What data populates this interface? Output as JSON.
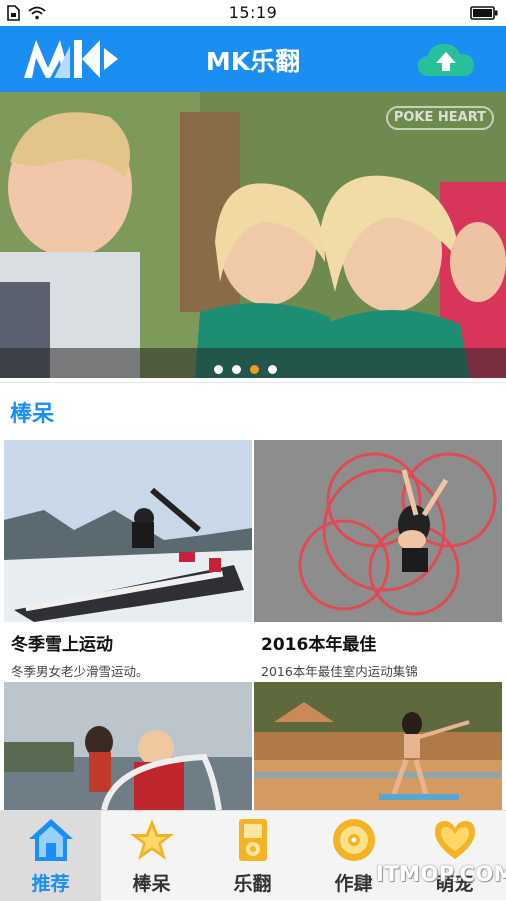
{
  "status_bar": {
    "time": "15:19"
  },
  "header": {
    "title": "MK乐翻",
    "upload_icon": "cloud-upload-icon",
    "logo": "mk-logo"
  },
  "banner": {
    "dots": 4,
    "active_dot": 3,
    "watermark": "POKE HEART"
  },
  "section": {
    "title": "棒呆"
  },
  "cards": [
    {
      "title": "冬季雪上运动",
      "subtitle": "冬季男女老少滑雪运动。"
    },
    {
      "title": "2016本年最佳",
      "subtitle": "2016本年最佳室内运动集锦"
    },
    {
      "title": "",
      "subtitle": ""
    },
    {
      "title": "",
      "subtitle": ""
    }
  ],
  "tabs": [
    {
      "label": "推荐",
      "icon": "home-icon",
      "active": true
    },
    {
      "label": "棒呆",
      "icon": "star-icon",
      "active": false
    },
    {
      "label": "乐翻",
      "icon": "music-player-icon",
      "active": false
    },
    {
      "label": "作肆",
      "icon": "disc-icon",
      "active": false
    },
    {
      "label": "萌宠",
      "icon": "heart-icon",
      "active": false
    }
  ],
  "watermark": "ITMOP.COM",
  "colors": {
    "brand": "#1a8ef2",
    "accent": "#f3b324",
    "active_dot": "#f39a1d"
  }
}
